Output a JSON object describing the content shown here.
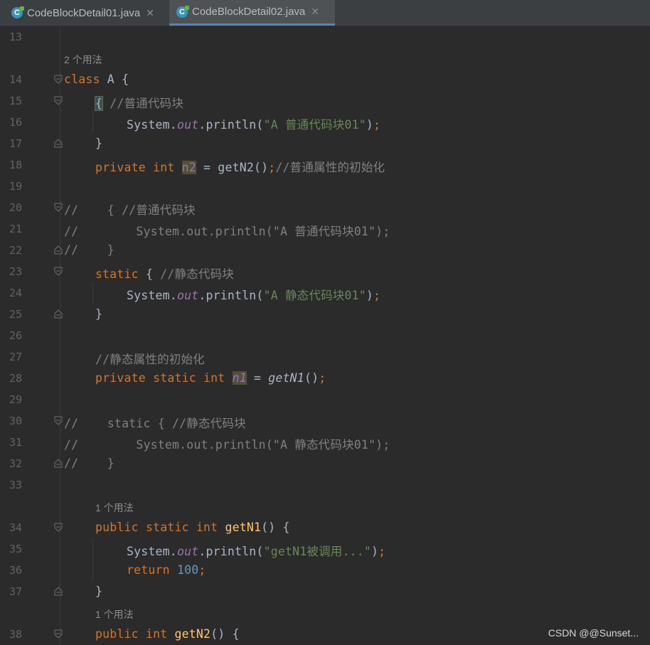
{
  "tabs": [
    {
      "label": "CodeBlockDetail01.java",
      "icon": "java-class-icon",
      "active": false
    },
    {
      "label": "CodeBlockDetail02.java",
      "icon": "java-class-icon",
      "active": true
    }
  ],
  "watermark": "CSDN @@Sunset...",
  "hints": {
    "h1": "2 个用法",
    "h2": "1 个用法",
    "h3": "1 个用法"
  },
  "lines": {
    "l13": "13",
    "l14": "14",
    "l15": "15",
    "l16": "16",
    "l17": "17",
    "l18": "18",
    "l19": "19",
    "l20": "20",
    "l21": "21",
    "l22": "22",
    "l23": "23",
    "l24": "24",
    "l25": "25",
    "l26": "26",
    "l27": "27",
    "l28": "28",
    "l29": "29",
    "l30": "30",
    "l31": "31",
    "l32": "32",
    "l33": "33",
    "l34": "34",
    "l35": "35",
    "l36": "36",
    "l37": "37",
    "l38": "38"
  },
  "code": {
    "c14_kw": "class",
    "c14_rest": " A {",
    "c15_brace": "{",
    "c15_cmt": " //普通代码块",
    "c16_a": "System.",
    "c16_out": "out",
    "c16_b": ".println(",
    "c16_str": "\"A 普通代码块01\"",
    "c16_c": ")",
    "c16_semi": ";",
    "c17": "}",
    "c18_kw": "private",
    "c18_int": "int",
    "c18_n2": "n2",
    "c18_mid": " = getN2()",
    "c18_semi": ";",
    "c18_cmt": "//普通属性的初始化",
    "c20": "//    { //普通代码块",
    "c21": "//        System.out.println(\"A 普通代码块01\");",
    "c22": "//    }",
    "c23_kw": "static",
    "c23_b": " { ",
    "c23_cmt": "//静态代码块",
    "c24_a": "System.",
    "c24_out": "out",
    "c24_b": ".println(",
    "c24_str": "\"A 静态代码块01\"",
    "c24_c": ")",
    "c24_semi": ";",
    "c25": "}",
    "c27": "//静态属性的初始化",
    "c28_kw1": "private",
    "c28_kw2": "static",
    "c28_kw3": "int",
    "c28_n1": "n1",
    "c28_eq": " = ",
    "c28_fn": "getN1",
    "c28_par": "()",
    "c28_semi": ";",
    "c30": "//    static { //静态代码块",
    "c31": "//        System.out.println(\"A 静态代码块01\");",
    "c32": "//    }",
    "c34_kw1": "public",
    "c34_kw2": "static",
    "c34_kw3": "int",
    "c34_fn": "getN1",
    "c34_rest": "() {",
    "c35_a": "System.",
    "c35_out": "out",
    "c35_b": ".println(",
    "c35_str": "\"getN1被调用...\"",
    "c35_c": ")",
    "c35_semi": ";",
    "c36_kw": "return",
    "c36_num": "100",
    "c36_semi": ";",
    "c37": "}",
    "c38_kw1": "public",
    "c38_kw2": "int",
    "c38_fn": "getN2",
    "c38_rest": "() {"
  }
}
